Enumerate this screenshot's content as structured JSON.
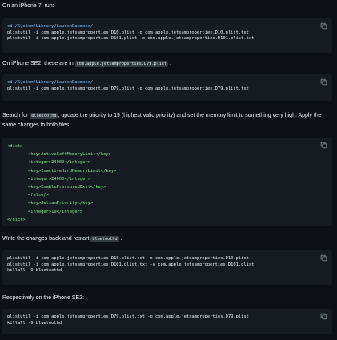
{
  "intro": "On an iPhone 7, run:",
  "block1": {
    "lines": [
      "cd /System/Library/LaunchDaemons/",
      "plistutil -i com.apple.jetsamproperties.D10.plist -o com.apple.jetsamproperties.D10.plist.txt",
      "plistutil -i com.apple.jetsamproperties.D101.plist -o com.apple.jetsamproperties.D101.plist.txt"
    ]
  },
  "se2_para": {
    "prefix": "On iPhone SE2, these are in ",
    "code": "com.apple.jetsamproperties.D79.plist",
    "suffix": " :"
  },
  "block2": {
    "lines": [
      "cd /System/Library/LaunchDaemons/",
      "plistutil -i com.apple.jetsamproperties.D79.plist -o com.apple.jetsamproperties.D79.plist.txt"
    ]
  },
  "search_para": {
    "prefix": "Search for ",
    "code": "bluetoothd",
    "suffix": ", update the priority to 19 (highest valid priority) and set the memory limit to something very high. Apply the same changes to both files."
  },
  "block3": {
    "lines": [
      "<dict>",
      "        <key>ActiveSoftMemoryLimit</key>",
      "        <integer>24000</integer>",
      "        <key>InactiveHardMemoryLimit</key>",
      "        <integer>24000</integer>",
      "        <key>EnablePressuredExit</key>",
      "        <false/>",
      "        <key>JetsamPriority</key>",
      "        <integer>19</integer>",
      "</dict>"
    ]
  },
  "write_para": {
    "prefix": "Write the changes back and restart ",
    "code": "bluetoothd",
    "suffix": " ."
  },
  "block4": {
    "lines": [
      "plistutil -i com.apple.jetsamproperties.D10.plist.txt -o com.apple.jetsamproperties.D10.plist",
      "plistutil -i com.apple.jetsamproperties.D101.plist.txt -o com.apple.jetsamproperties.D101.plist",
      "killall -9 bluetoothd"
    ]
  },
  "resp_para": "Respectively on the iPhone SE2:",
  "block5": {
    "lines": [
      "plistutil -i com.apple.jetsamproperties.D79.plist.txt -o com.apple.jetsamproperties.D79.plist",
      "killall -9 bluetoothd"
    ]
  },
  "icons": {
    "copy": "copy-icon"
  }
}
